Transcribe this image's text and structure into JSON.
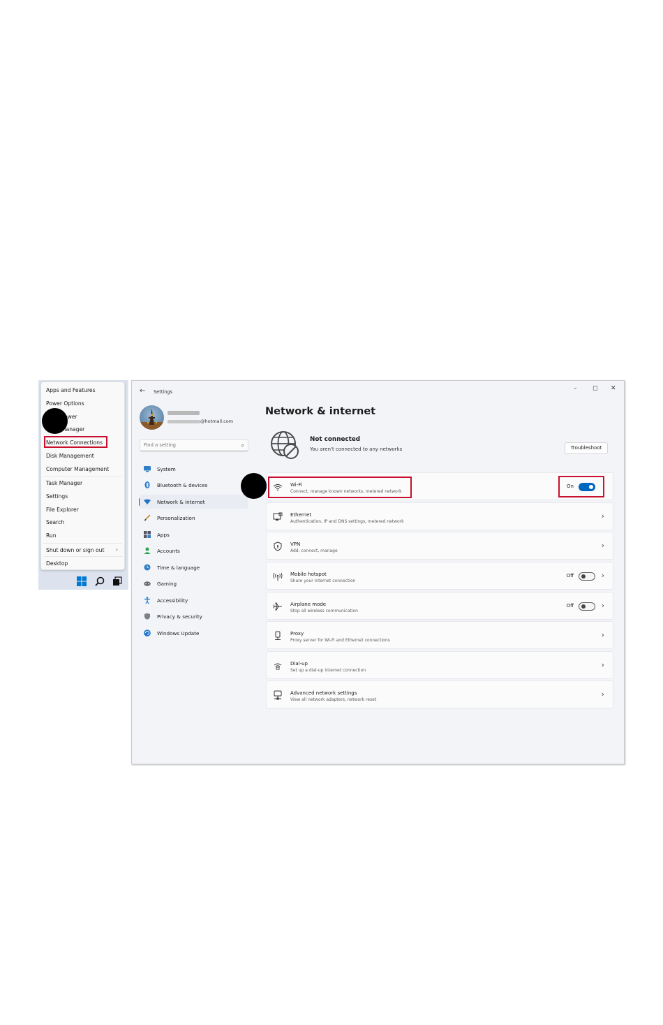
{
  "winx_menu": {
    "items": [
      {
        "label": "Apps and Features"
      },
      {
        "label": "Power Options"
      },
      {
        "label": "ewer"
      },
      {
        "label": "Manager"
      },
      {
        "label": "Network Connections"
      },
      {
        "label": "Disk Management"
      },
      {
        "label": "Computer Management"
      },
      {
        "label": "Task Manager"
      },
      {
        "label": "Settings"
      },
      {
        "label": "File Explorer"
      },
      {
        "label": "Search"
      },
      {
        "label": "Run"
      },
      {
        "label": "Shut down or sign out",
        "arrow": "›"
      },
      {
        "label": "Desktop"
      }
    ]
  },
  "taskbar": {
    "icons": [
      "start-icon",
      "search-icon",
      "task-view-icon"
    ],
    "accent": "#0078d4"
  },
  "settings": {
    "app_title": "Settings",
    "back_glyph": "←",
    "window_controls": {
      "minimize": "–",
      "maximize": "◻",
      "close": "✕"
    },
    "profile": {
      "email": "@hotmail.com"
    },
    "search": {
      "placeholder": "Find a setting",
      "icon": "⌕"
    },
    "nav": [
      {
        "label": "System",
        "icon": "monitor-icon"
      },
      {
        "label": "Bluetooth & devices",
        "icon": "bluetooth-icon"
      },
      {
        "label": "Network & internet",
        "icon": "wifi-diamond-icon",
        "active": true
      },
      {
        "label": "Personalization",
        "icon": "brush-icon"
      },
      {
        "label": "Apps",
        "icon": "apps-icon"
      },
      {
        "label": "Accounts",
        "icon": "person-icon"
      },
      {
        "label": "Time & language",
        "icon": "globe-clock-icon"
      },
      {
        "label": "Gaming",
        "icon": "gamepad-icon"
      },
      {
        "label": "Accessibility",
        "icon": "accessibility-icon"
      },
      {
        "label": "Privacy & security",
        "icon": "shield-icon"
      },
      {
        "label": "Windows Update",
        "icon": "update-icon"
      }
    ],
    "page_title": "Network & internet",
    "status": {
      "title": "Not connected",
      "subtitle": "You aren't connected to any networks",
      "button": "Troubleshoot"
    },
    "cards": [
      {
        "title": "Wi-Fi",
        "desc": "Connect, manage known networks, metered network",
        "toggle": "On",
        "toggle_on": true,
        "icon": "wifi-icon"
      },
      {
        "title": "Ethernet",
        "desc": "Authentication, IP and DNS settings, metered network",
        "chevron": "›",
        "icon": "ethernet-icon"
      },
      {
        "title": "VPN",
        "desc": "Add, connect, manage",
        "chevron": "›",
        "icon": "vpn-shield-icon"
      },
      {
        "title": "Mobile hotspot",
        "desc": "Share your internet connection",
        "toggle": "Off",
        "toggle_on": false,
        "chevron": "›",
        "icon": "hotspot-icon"
      },
      {
        "title": "Airplane mode",
        "desc": "Stop all wireless communication",
        "toggle": "Off",
        "toggle_on": false,
        "chevron": "›",
        "icon": "airplane-icon"
      },
      {
        "title": "Proxy",
        "desc": "Proxy server for Wi-Fi and Ethernet connections",
        "chevron": "›",
        "icon": "proxy-icon"
      },
      {
        "title": "Dial-up",
        "desc": "Set up a dial-up internet connection",
        "chevron": "›",
        "icon": "dialup-icon"
      },
      {
        "title": "Advanced network settings",
        "desc": "View all network adapters, network reset",
        "chevron": "›",
        "icon": "network-adapter-icon"
      }
    ]
  },
  "colors": {
    "highlight": "#c8102e",
    "accent": "#0067c0"
  }
}
